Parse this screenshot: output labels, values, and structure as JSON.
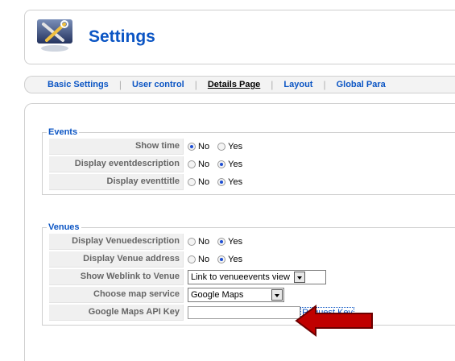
{
  "header": {
    "title": "Settings",
    "icon": "tools-icon"
  },
  "tabs": [
    {
      "label": "Basic Settings",
      "active": false
    },
    {
      "label": "User control",
      "active": false
    },
    {
      "label": "Details Page",
      "active": true
    },
    {
      "label": "Layout",
      "active": false
    },
    {
      "label": "Global Para",
      "active": false
    }
  ],
  "events": {
    "legend": "Events",
    "rows": [
      {
        "label": "Show time",
        "no": "No",
        "yes": "Yes",
        "selected": "No"
      },
      {
        "label": "Display eventdescription",
        "no": "No",
        "yes": "Yes",
        "selected": "Yes"
      },
      {
        "label": "Display eventtitle",
        "no": "No",
        "yes": "Yes",
        "selected": "Yes"
      }
    ]
  },
  "venues": {
    "legend": "Venues",
    "description": {
      "label": "Display Venuedescription",
      "no": "No",
      "yes": "Yes",
      "selected": "Yes"
    },
    "address": {
      "label": "Display Venue address",
      "no": "No",
      "yes": "Yes",
      "selected": "Yes"
    },
    "weblink": {
      "label": "Show Weblink to Venue",
      "value": "Link to venueevents view"
    },
    "map_service": {
      "label": "Choose map service",
      "value": "Google Maps"
    },
    "api_key": {
      "label": "Google Maps API Key",
      "value": "",
      "link": "Request Key"
    }
  },
  "colors": {
    "accent": "#0b55c4",
    "arrow": "#c00000"
  }
}
